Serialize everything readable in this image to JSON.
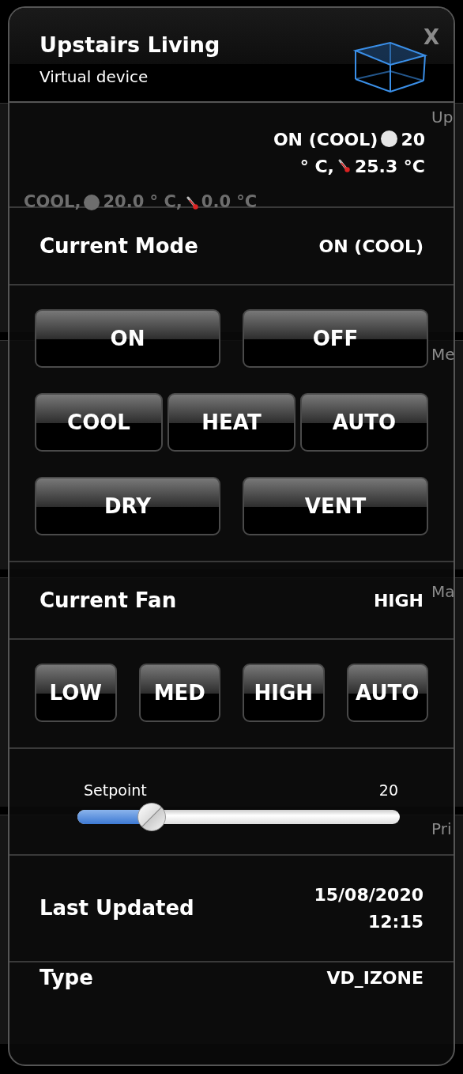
{
  "background": {
    "cards": [
      {
        "title": "Up",
        "status": {
          "mode": "COOL,",
          "setpoint": "20.0 ° C,",
          "temperature": "0.0 °C"
        }
      },
      {
        "title": "Me"
      },
      {
        "title": "Ma"
      },
      {
        "title": "Pri"
      }
    ]
  },
  "dialog": {
    "title": "Upstairs Living",
    "subtitle": "Virtual device",
    "close": "X"
  },
  "status": {
    "mode": "ON (COOL)",
    "setpoint": "20",
    "unit": "° C,",
    "temperature": "25.3 °C"
  },
  "sections": [
    {
      "kind": "info",
      "label": "Current Mode",
      "value": "ON (COOL)"
    },
    {
      "kind": "buttons",
      "rows": [
        [
          "ON",
          "OFF"
        ],
        [
          "COOL",
          "HEAT",
          "AUTO"
        ],
        [
          "DRY",
          "VENT"
        ]
      ]
    },
    {
      "kind": "info",
      "label": "Current Fan",
      "value": "HIGH"
    },
    {
      "kind": "buttons",
      "rows": [
        [
          "LOW",
          "MED",
          "HIGH",
          "AUTO"
        ]
      ]
    },
    {
      "kind": "slider",
      "label": "Setpoint",
      "reading": "20",
      "level": 0.23
    },
    {
      "kind": "info",
      "label": "Last Updated",
      "value": "15/08/2020 12:15"
    },
    {
      "kind": "info",
      "label": "Type",
      "value": "VD_IZONE"
    }
  ]
}
